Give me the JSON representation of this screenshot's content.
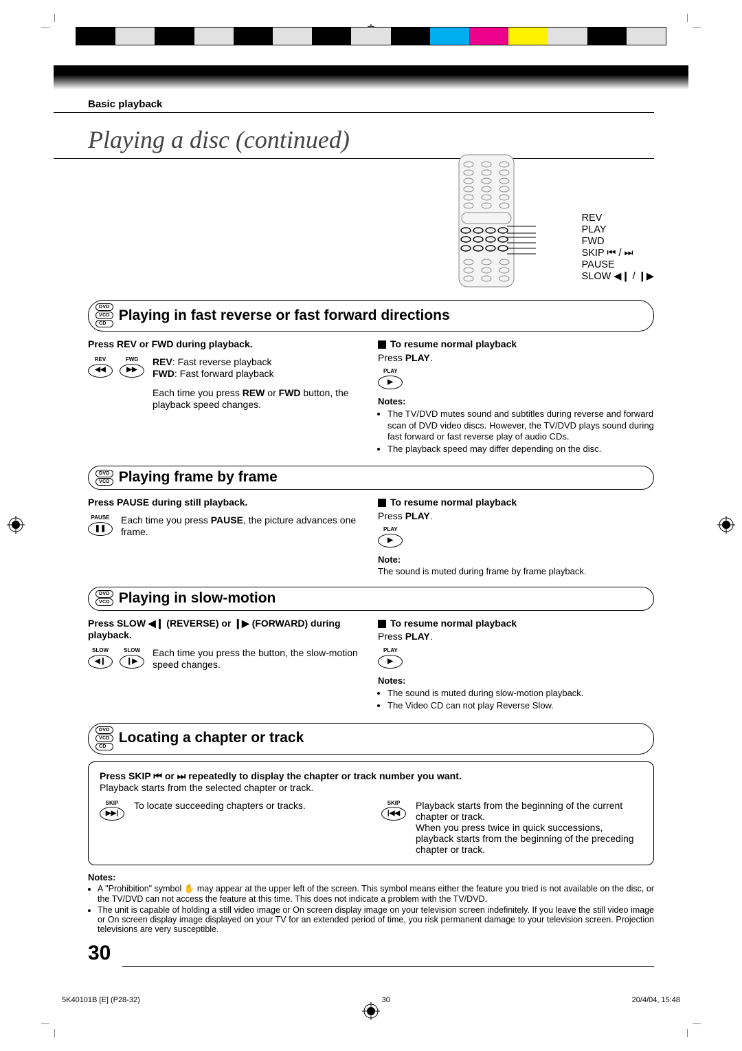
{
  "header": {
    "section_label": "Basic playback",
    "title": "Playing a disc (continued)"
  },
  "remote": {
    "rev": "REV",
    "play": "PLAY",
    "fwd": "FWD",
    "skip": "SKIP ⏮ / ⏭",
    "pause": "PAUSE",
    "slow": "SLOW ◀❙ / ❙▶"
  },
  "s1": {
    "badges": [
      "DVD",
      "VCD",
      "CD"
    ],
    "title": "Playing in fast reverse or fast forward directions",
    "left_title": "Press REV or FWD during playback.",
    "btn_rev": "REV",
    "btn_fwd": "FWD",
    "rev_desc_label": "REV",
    "rev_desc": ": Fast reverse playback",
    "fwd_desc_label": "FWD",
    "fwd_desc": ": Fast forward playback",
    "each_a": "Each time you press ",
    "each_b": "REW",
    "each_c": " or ",
    "each_d": "FWD",
    "each_e": " button, the playback speed changes.",
    "resume_title": "To resume normal playback",
    "resume_a": "Press ",
    "resume_b": "PLAY",
    "resume_c": ".",
    "play_btn": "PLAY",
    "notes_label": "Notes:",
    "notes": [
      "The TV/DVD mutes sound and subtitles during reverse and forward scan of DVD video discs. However, the TV/DVD plays sound during fast forward or fast reverse play of audio CDs.",
      "The playback speed may differ depending on the disc."
    ]
  },
  "s2": {
    "badges": [
      "DVD",
      "VCD"
    ],
    "title": "Playing frame by frame",
    "left_title": "Press PAUSE during still playback.",
    "btn_label": "PAUSE",
    "each_a": "Each time you press ",
    "each_b": "PAUSE",
    "each_c": ", the picture advances one frame.",
    "resume_title": "To resume normal playback",
    "resume_a": "Press ",
    "resume_b": "PLAY",
    "resume_c": ".",
    "play_btn": "PLAY",
    "notes_label": "Note:",
    "note": "The sound is muted during frame by frame playback."
  },
  "s3": {
    "badges": [
      "DVD",
      "VCD"
    ],
    "title": "Playing in slow-motion",
    "left_title": "Press SLOW ◀❙ (REVERSE) or ❙▶ (FORWARD) during playback.",
    "btn_label1": "SLOW",
    "btn_label2": "SLOW",
    "each": "Each time you press the button, the slow-motion speed changes.",
    "resume_title": "To resume normal playback",
    "resume_a": "Press ",
    "resume_b": "PLAY",
    "resume_c": ".",
    "play_btn": "PLAY",
    "notes_label": "Notes:",
    "notes": [
      "The sound is muted during slow-motion playback.",
      "The Video CD can not play Reverse Slow."
    ]
  },
  "s4": {
    "badges": [
      "DVD",
      "VCD",
      "CD"
    ],
    "title": "Locating a chapter or track",
    "line1": "Press SKIP ⏮ or ⏭ repeatedly to display the chapter or track number you want.",
    "line2": "Playback starts from the selected chapter or track.",
    "skip_fwd_label": "SKIP",
    "skip_fwd_desc": "To locate succeeding chapters or tracks.",
    "skip_back_label": "SKIP",
    "skip_back_desc1": "Playback starts from the beginning of the current chapter or track.",
    "skip_back_desc2": "When you press twice in quick successions, playback starts from the beginning of the preceding chapter or track."
  },
  "footnotes": {
    "label": "Notes:",
    "items": [
      "A \"Prohibition\" symbol ✋ may appear at the upper left of the screen. This symbol means either the feature you tried is not available on the disc, or the TV/DVD can not access the feature at this time. This does not indicate a problem with the TV/DVD.",
      "The unit is capable of holding a still video image or On screen display image on your television screen indefinitely. If you leave the still video image or On screen display image displayed on your TV for an extended period of time, you risk permanent damage to your television screen. Projection televisions are very susceptible."
    ]
  },
  "page_number": "30",
  "print_footer": {
    "left": "5K40101B [E] (P28-32)",
    "mid": "30",
    "right": "20/4/04, 15:48"
  }
}
